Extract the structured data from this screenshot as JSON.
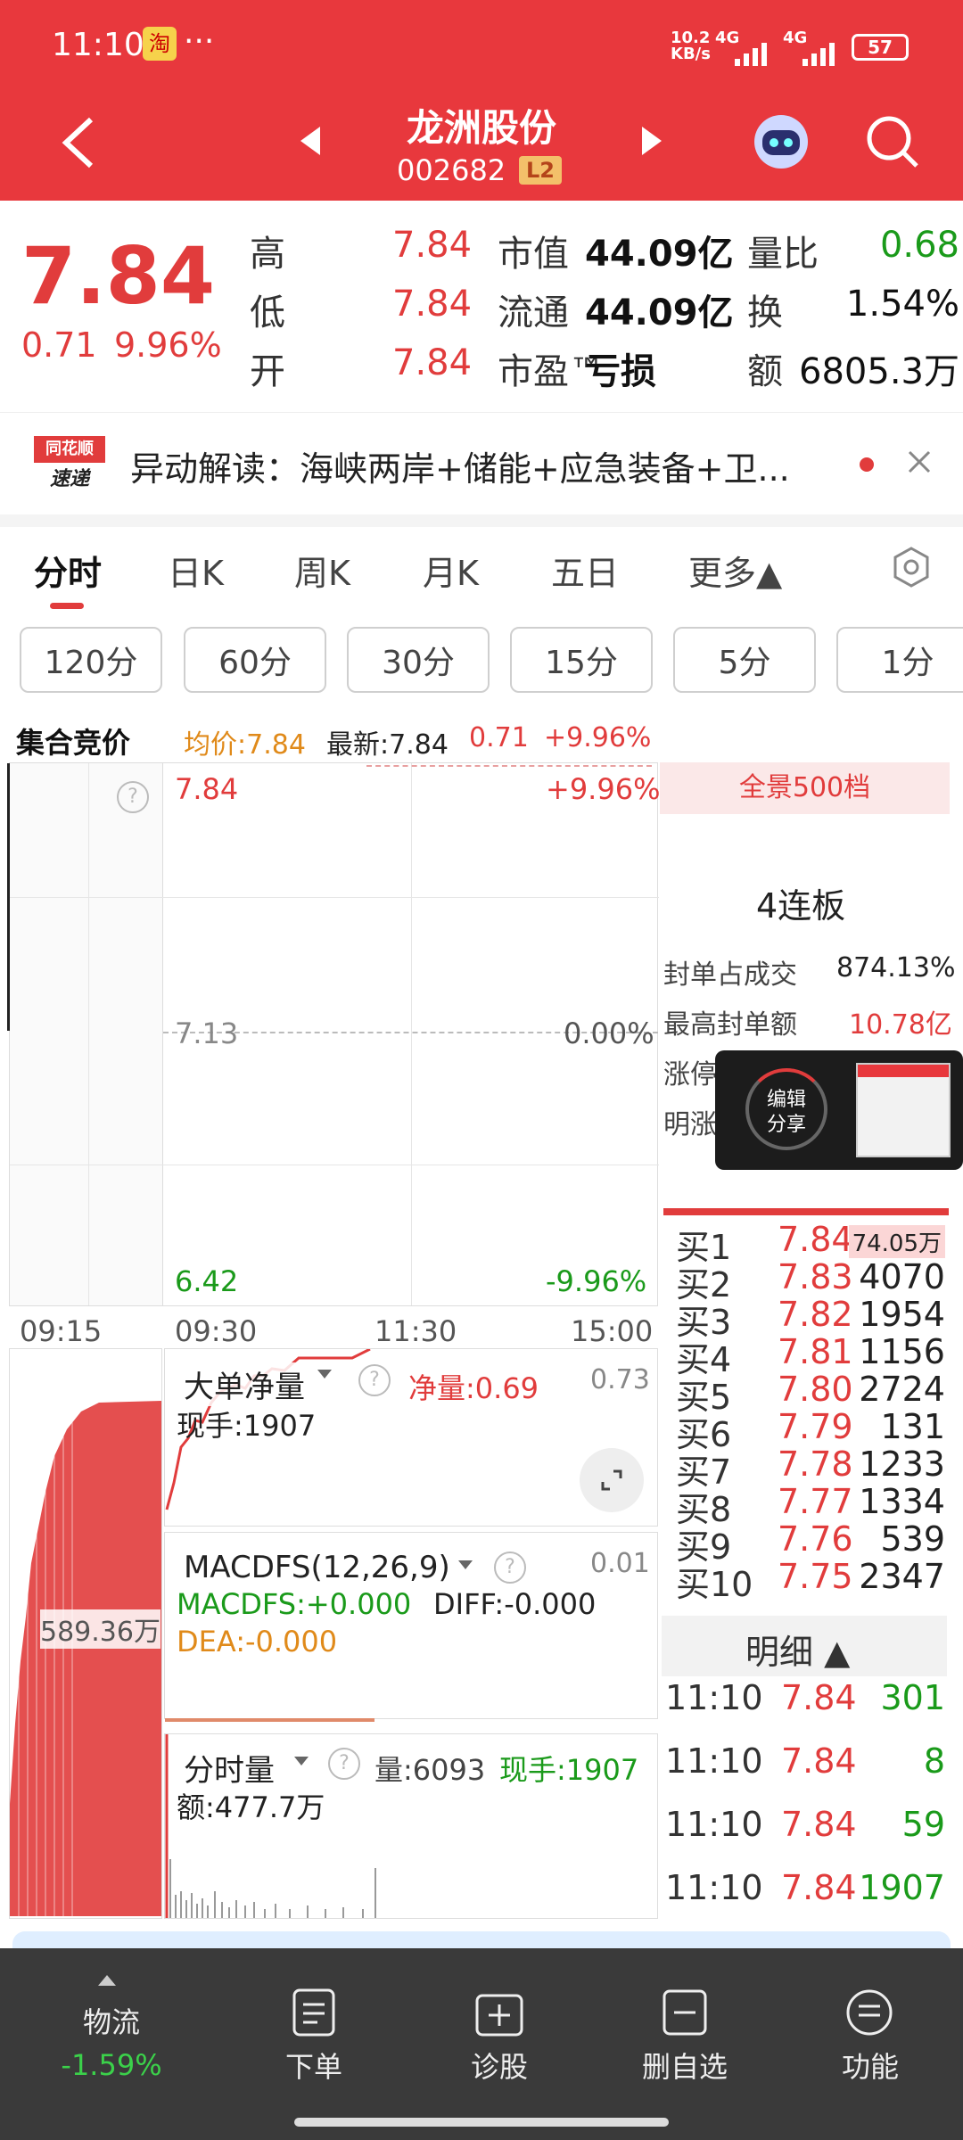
{
  "status": {
    "time": "11:10",
    "speed": "10.2\nKB/s",
    "net1": "4G",
    "net2": "4G",
    "battery": "57",
    "more": "···",
    "app_icon": "淘"
  },
  "nav": {
    "title": "龙洲股份",
    "code": "002682",
    "level": "L2"
  },
  "quote": {
    "price": "7.84",
    "change": "0.71",
    "change_pct": "9.96%",
    "rows": [
      {
        "l1": "高",
        "v1": "7.84",
        "l2": "市值",
        "v2": "44.09亿",
        "l3": "量比",
        "v3": "0.68"
      },
      {
        "l1": "低",
        "v1": "7.84",
        "l2": "流通",
        "v2": "44.09亿",
        "l3": "换",
        "v3": "1.54%"
      },
      {
        "l1": "开",
        "v1": "7.84",
        "l2": "市盈™",
        "v2": "亏损",
        "l3": "额",
        "v3": "6805.3万"
      }
    ]
  },
  "news": {
    "logo_top": "同花顺",
    "logo_bottom": "速递",
    "text": "异动解读：海峡两岸+储能+应急装备+卫..."
  },
  "tabs": {
    "t1": "分时",
    "t2": "日K",
    "t3": "周K",
    "t4": "月K",
    "t5": "五日",
    "t6": "更多▲"
  },
  "periods": {
    "p1": "120分",
    "p2": "60分",
    "p3": "30分",
    "p4": "15分",
    "p5": "5分",
    "p6": "1分"
  },
  "chart": {
    "auction": "集合竞价",
    "avg": "均价:7.84",
    "latest": "最新:7.84",
    "chg": "0.71",
    "chg_pct": "+9.96%",
    "top_price": "7.84",
    "top_pct": "+9.96%",
    "mid_price": "7.13",
    "mid_pct": "0.00%",
    "bottom_price": "6.42",
    "bottom_pct": "-9.96%",
    "times": {
      "t1": "09:15",
      "t2": "09:30",
      "t3": "11:30",
      "t4": "15:00"
    },
    "big_order": "大单净量",
    "net_label": "净量:0.69",
    "net_max": "0.73",
    "now_hand": "现手:1907",
    "auction_vol": "589.36万",
    "macd_title": "MACDFS(12,26,9)",
    "macd_max": "0.01",
    "macd_val": "MACDFS:+0.000",
    "diff_val": "DIFF:-0.000",
    "dea_val": "DEA:-0.000",
    "vol_title": "分时量",
    "vol_val": "量:6093",
    "vol_hand": "现手:1907",
    "amount": "额:477.7万"
  },
  "side": {
    "panorama": "全景500档",
    "streak": "4连板",
    "seal_label": "封单占成交",
    "seal_val": "874.13%",
    "max_seal_label": "最高封单额",
    "max_seal_val": "10.78亿",
    "limit_label": "涨停成交额",
    "limit2_label": "明涨停",
    "share_top": "编辑",
    "share_bottom": "分享",
    "bids": [
      {
        "n": "买1",
        "p": "7.84",
        "v": "74.05万"
      },
      {
        "n": "买2",
        "p": "7.83",
        "v": "4070"
      },
      {
        "n": "买3",
        "p": "7.82",
        "v": "1954"
      },
      {
        "n": "买4",
        "p": "7.81",
        "v": "1156"
      },
      {
        "n": "买5",
        "p": "7.80",
        "v": "2724"
      },
      {
        "n": "买6",
        "p": "7.79",
        "v": "131"
      },
      {
        "n": "买7",
        "p": "7.78",
        "v": "1233"
      },
      {
        "n": "买8",
        "p": "7.77",
        "v": "1334"
      },
      {
        "n": "买9",
        "p": "7.76",
        "v": "539"
      },
      {
        "n": "买10",
        "p": "7.75",
        "v": "2347"
      }
    ],
    "detail_title": "明细 ▲",
    "ticks": [
      {
        "t": "11:10",
        "p": "7.84",
        "v": "301"
      },
      {
        "t": "11:10",
        "p": "7.84",
        "v": "8"
      },
      {
        "t": "11:10",
        "p": "7.84",
        "v": "59"
      },
      {
        "t": "11:10",
        "p": "7.84",
        "v": "1907"
      }
    ]
  },
  "bottom": {
    "b1": "物流",
    "b1v": "-1.59%",
    "b2": "下单",
    "b3": "诊股",
    "b4": "删自选",
    "b5": "功能"
  }
}
